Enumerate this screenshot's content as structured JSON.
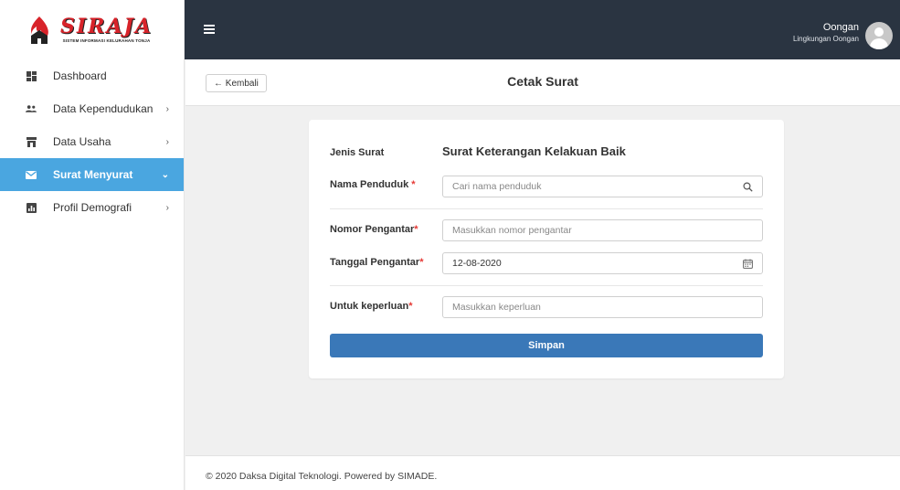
{
  "brand": {
    "logo_title": "SIRAJA",
    "logo_subtitle": "SISTEM INFORMASI KELURAHAN TONJA"
  },
  "sidebar": {
    "items": [
      {
        "label": "Dashboard",
        "icon": "dashboard-icon",
        "has_chevron": false
      },
      {
        "label": "Data Kependudukan",
        "icon": "users-icon",
        "chevron": "›"
      },
      {
        "label": "Data Usaha",
        "icon": "store-icon",
        "chevron": "›"
      },
      {
        "label": "Surat Menyurat",
        "icon": "mail-icon",
        "chevron": "⌄",
        "active": true
      },
      {
        "label": "Profil Demografi",
        "icon": "chart-icon",
        "chevron": "›"
      }
    ]
  },
  "topbar": {
    "user_name": "Oongan",
    "user_role": "Lingkungan Oongan"
  },
  "page": {
    "back_label": "← Kembali",
    "title": "Cetak Surat"
  },
  "form": {
    "jenis_label": "Jenis Surat",
    "jenis_value": "Surat Keterangan Kelakuan Baik",
    "nama_label": "Nama Penduduk",
    "nama_req": " *",
    "nama_placeholder": "Cari nama penduduk",
    "nomor_label": "Nomor Pengantar",
    "nomor_req": "*",
    "nomor_placeholder": "Masukkan nomor pengantar",
    "tanggal_label": "Tanggal Pengantar",
    "tanggal_req": "*",
    "tanggal_value": "12-08-2020",
    "keperluan_label": "Untuk keperluan",
    "keperluan_req": "*",
    "keperluan_placeholder": "Masukkan keperluan",
    "submit_label": "Simpan"
  },
  "footer": {
    "text": "© 2020 Daksa Digital Teknologi. Powered by SIMADE."
  },
  "colors": {
    "topbar": "#2a3441",
    "active_menu": "#4aa6e0",
    "primary_button": "#3a78b8",
    "required": "#e53935",
    "brand_red": "#d8232a"
  }
}
